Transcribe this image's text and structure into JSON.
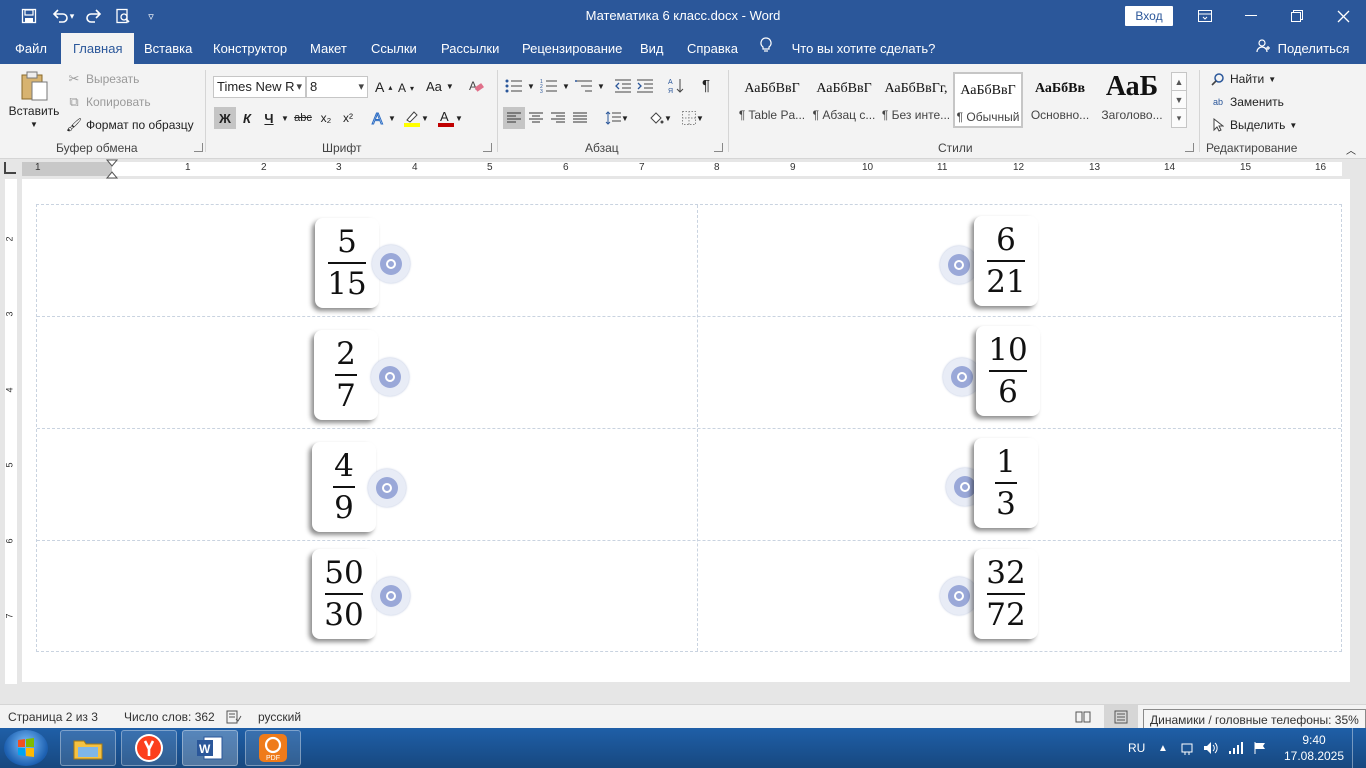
{
  "titlebar": {
    "title": "Математика 6 класс.docx  -  Word",
    "signin_label": "Вход",
    "qat_icons": [
      "save-icon",
      "undo-icon",
      "redo-icon",
      "print-preview-icon",
      "customize-icon"
    ]
  },
  "tabs": [
    {
      "label": "Файл"
    },
    {
      "label": "Главная",
      "active": true
    },
    {
      "label": "Вставка"
    },
    {
      "label": "Конструктор"
    },
    {
      "label": "Макет"
    },
    {
      "label": "Ссылки"
    },
    {
      "label": "Рассылки"
    },
    {
      "label": "Рецензирование"
    },
    {
      "label": "Вид"
    },
    {
      "label": "Справка"
    }
  ],
  "tellme": "Что вы хотите сделать?",
  "share": "Поделиться",
  "ribbon": {
    "clipboard": {
      "paste": "Вставить",
      "cut": "Вырезать",
      "copy": "Копировать",
      "format_painter": "Формат по образцу",
      "label": "Буфер обмена"
    },
    "font": {
      "name": "Times New R",
      "size": "8",
      "label": "Шрифт",
      "bold": "Ж",
      "italic": "К",
      "underline": "Ч",
      "strike": "abc",
      "subscript": "x₂",
      "superscript": "x²",
      "case": "Aa"
    },
    "paragraph": {
      "label": "Абзац",
      "pilcrow": "¶"
    },
    "styles": {
      "label": "Стили",
      "items": [
        {
          "sample": "АаБбВвГ",
          "name": "¶ Table Pa..."
        },
        {
          "sample": "АаБбВвГ",
          "name": "¶ Абзац с..."
        },
        {
          "sample": "АаБбВвГг,",
          "name": "¶ Без инте..."
        },
        {
          "sample": "АаБбВвГ",
          "name": "¶ Обычный",
          "selected": true
        },
        {
          "sample": "АаБбВв",
          "name": "Основно..."
        },
        {
          "sample": "АаБ",
          "name": "Заголово..."
        }
      ]
    },
    "editing": {
      "label": "Редактирование",
      "find": "Найти",
      "replace": "Заменить",
      "select": "Выделить"
    }
  },
  "ruler": {
    "numbers": [
      "1",
      "1",
      "2",
      "3",
      "4",
      "5",
      "6",
      "7",
      "8",
      "9",
      "10",
      "11",
      "12",
      "13",
      "14",
      "15",
      "16"
    ],
    "vnumbers": [
      "2",
      "3",
      "4",
      "5",
      "6",
      "7"
    ]
  },
  "fractions": [
    {
      "num": "5",
      "den": "15"
    },
    {
      "num": "6",
      "den": "21"
    },
    {
      "num": "2",
      "den": "7"
    },
    {
      "num": "10",
      "den": "6"
    },
    {
      "num": "4",
      "den": "9"
    },
    {
      "num": "1",
      "den": "3"
    },
    {
      "num": "50",
      "den": "30"
    },
    {
      "num": "32",
      "den": "72"
    }
  ],
  "statusbar": {
    "page": "Страница 2 из 3",
    "words": "Число слов: 362",
    "language": "русский"
  },
  "tooltip": "Динамики / головные телефоны: 35%",
  "taskbar": {
    "lang": "RU",
    "time": "9:40",
    "date": "17.08.2025",
    "apps": [
      "file-explorer-icon",
      "yandex-browser-icon",
      "word-icon",
      "pdf-app-icon"
    ]
  }
}
